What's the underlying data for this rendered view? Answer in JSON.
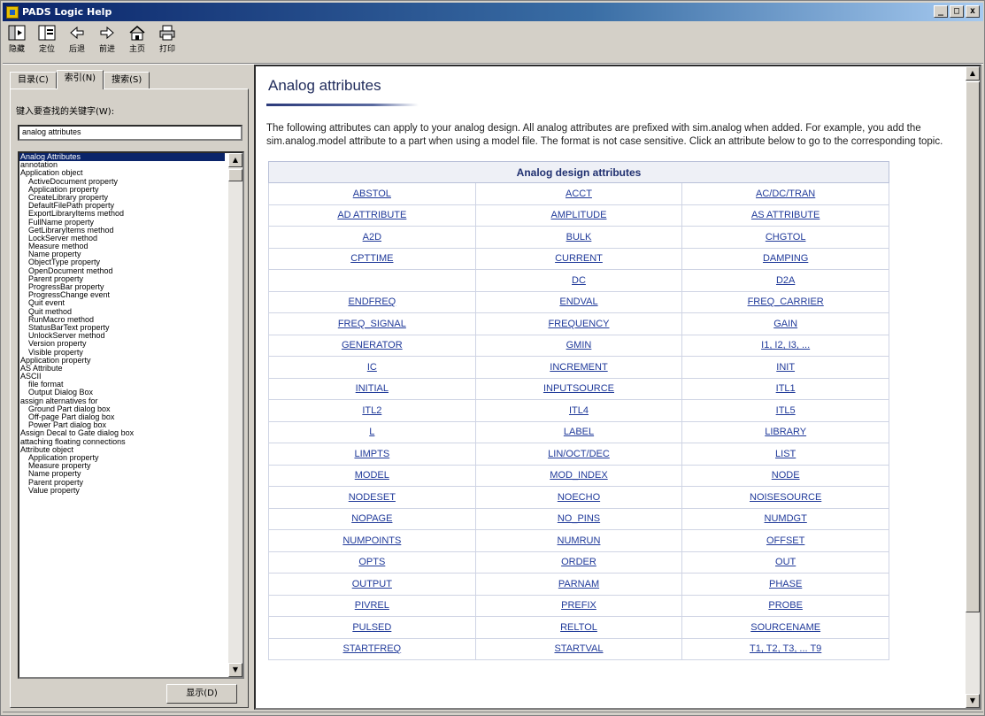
{
  "window": {
    "title": "PADS Logic Help",
    "controls": [
      "_",
      "□",
      "x"
    ]
  },
  "toolbar": [
    {
      "icon": "hide-icon",
      "label": "隐藏"
    },
    {
      "icon": "locate-icon",
      "label": "定位"
    },
    {
      "icon": "back-icon",
      "label": "后退"
    },
    {
      "icon": "forward-icon",
      "label": "前进"
    },
    {
      "icon": "home-icon",
      "label": "主页"
    },
    {
      "icon": "print-icon",
      "label": "打印"
    }
  ],
  "left": {
    "tabs": [
      {
        "label": "目录(C)",
        "active": false
      },
      {
        "label": "索引(N)",
        "active": true
      },
      {
        "label": "搜索(S)",
        "active": false
      }
    ],
    "keyword_label": "键入要查找的关键字(W):",
    "keyword_value": "analog attributes",
    "display_button": "显示(D)",
    "items": [
      {
        "text": "Analog Attributes",
        "indent": false,
        "selected": true
      },
      {
        "text": "annotation",
        "indent": false
      },
      {
        "text": "Application object",
        "indent": false
      },
      {
        "text": "ActiveDocument property",
        "indent": true
      },
      {
        "text": "Application property",
        "indent": true
      },
      {
        "text": "CreateLibrary property",
        "indent": true
      },
      {
        "text": "DefaultFilePath property",
        "indent": true
      },
      {
        "text": "ExportLibraryItems method",
        "indent": true
      },
      {
        "text": "FullName property",
        "indent": true
      },
      {
        "text": "GetLibraryItems method",
        "indent": true
      },
      {
        "text": "LockServer method",
        "indent": true
      },
      {
        "text": "Measure method",
        "indent": true
      },
      {
        "text": "Name property",
        "indent": true
      },
      {
        "text": "ObjectType property",
        "indent": true
      },
      {
        "text": "OpenDocument method",
        "indent": true
      },
      {
        "text": "Parent property",
        "indent": true
      },
      {
        "text": "ProgressBar property",
        "indent": true
      },
      {
        "text": "ProgressChange event",
        "indent": true
      },
      {
        "text": "Quit event",
        "indent": true
      },
      {
        "text": "Quit method",
        "indent": true
      },
      {
        "text": "RunMacro method",
        "indent": true
      },
      {
        "text": "StatusBarText property",
        "indent": true
      },
      {
        "text": "UnlockServer method",
        "indent": true
      },
      {
        "text": "Version property",
        "indent": true
      },
      {
        "text": "Visible property",
        "indent": true
      },
      {
        "text": "Application property",
        "indent": false
      },
      {
        "text": "AS Attribute",
        "indent": false
      },
      {
        "text": "ASCII",
        "indent": false
      },
      {
        "text": "file format",
        "indent": true
      },
      {
        "text": "Output Dialog Box",
        "indent": true
      },
      {
        "text": "assign alternatives for",
        "indent": false
      },
      {
        "text": "Ground Part dialog box",
        "indent": true
      },
      {
        "text": "Off-page Part dialog box",
        "indent": true
      },
      {
        "text": "Power Part dialog box",
        "indent": true
      },
      {
        "text": "Assign Decal to Gate dialog box",
        "indent": false
      },
      {
        "text": "attaching floating connections",
        "indent": false
      },
      {
        "text": "Attribute object",
        "indent": false
      },
      {
        "text": "Application property",
        "indent": true
      },
      {
        "text": "Measure property",
        "indent": true
      },
      {
        "text": "Name property",
        "indent": true
      },
      {
        "text": "Parent property",
        "indent": true
      },
      {
        "text": "Value property",
        "indent": true
      }
    ]
  },
  "page": {
    "title": "Analog attributes",
    "intro": "The following attributes can apply to your analog design. All analog attributes are prefixed with sim.analog when added. For example, you add the sim.analog.model attribute to a part when using a model file. The format is not case sensitive. Click an attribute below to go to the corresponding topic.",
    "table_header": "Analog design attributes",
    "rows": [
      [
        "ABSTOL",
        "ACCT",
        "AC/DC/TRAN"
      ],
      [
        "AD ATTRIBUTE",
        "AMPLITUDE",
        "AS ATTRIBUTE"
      ],
      [
        "A2D",
        "BULK",
        "CHGTOL"
      ],
      [
        "CPTTIME",
        "CURRENT",
        "DAMPING"
      ],
      [
        "",
        "DC",
        "D2A"
      ],
      [
        "ENDFREQ",
        "ENDVAL",
        "FREQ_CARRIER"
      ],
      [
        "FREQ_SIGNAL",
        "FREQUENCY",
        "GAIN"
      ],
      [
        "GENERATOR",
        "GMIN",
        "I1, I2, I3, ..."
      ],
      [
        "IC",
        "INCREMENT",
        "INIT"
      ],
      [
        "INITIAL",
        "INPUTSOURCE",
        "ITL1"
      ],
      [
        "ITL2",
        "ITL4",
        "ITL5"
      ],
      [
        "L",
        "LABEL",
        "LIBRARY"
      ],
      [
        "LIMPTS",
        "LIN/OCT/DEC",
        "LIST"
      ],
      [
        "MODEL",
        "MOD_INDEX",
        "NODE"
      ],
      [
        "NODESET",
        "NOECHO",
        "NOISESOURCE"
      ],
      [
        "NOPAGE",
        "NO_PINS",
        "NUMDGT"
      ],
      [
        "NUMPOINTS",
        "NUMRUN",
        "OFFSET"
      ],
      [
        "OPTS",
        "ORDER",
        "OUT"
      ],
      [
        "OUTPUT",
        "PARNAM",
        "PHASE"
      ],
      [
        "PIVREL",
        "PREFIX",
        "PROBE"
      ],
      [
        "PULSED",
        "RELTOL",
        "SOURCENAME"
      ],
      [
        "STARTFREQ",
        "STARTVAL",
        "T1, T2, T3, ... T9"
      ]
    ]
  },
  "colors": {
    "title_bar": "#0a246a",
    "link": "#203a9a",
    "selection": "#0a246a",
    "heading": "#1e2a5a"
  }
}
